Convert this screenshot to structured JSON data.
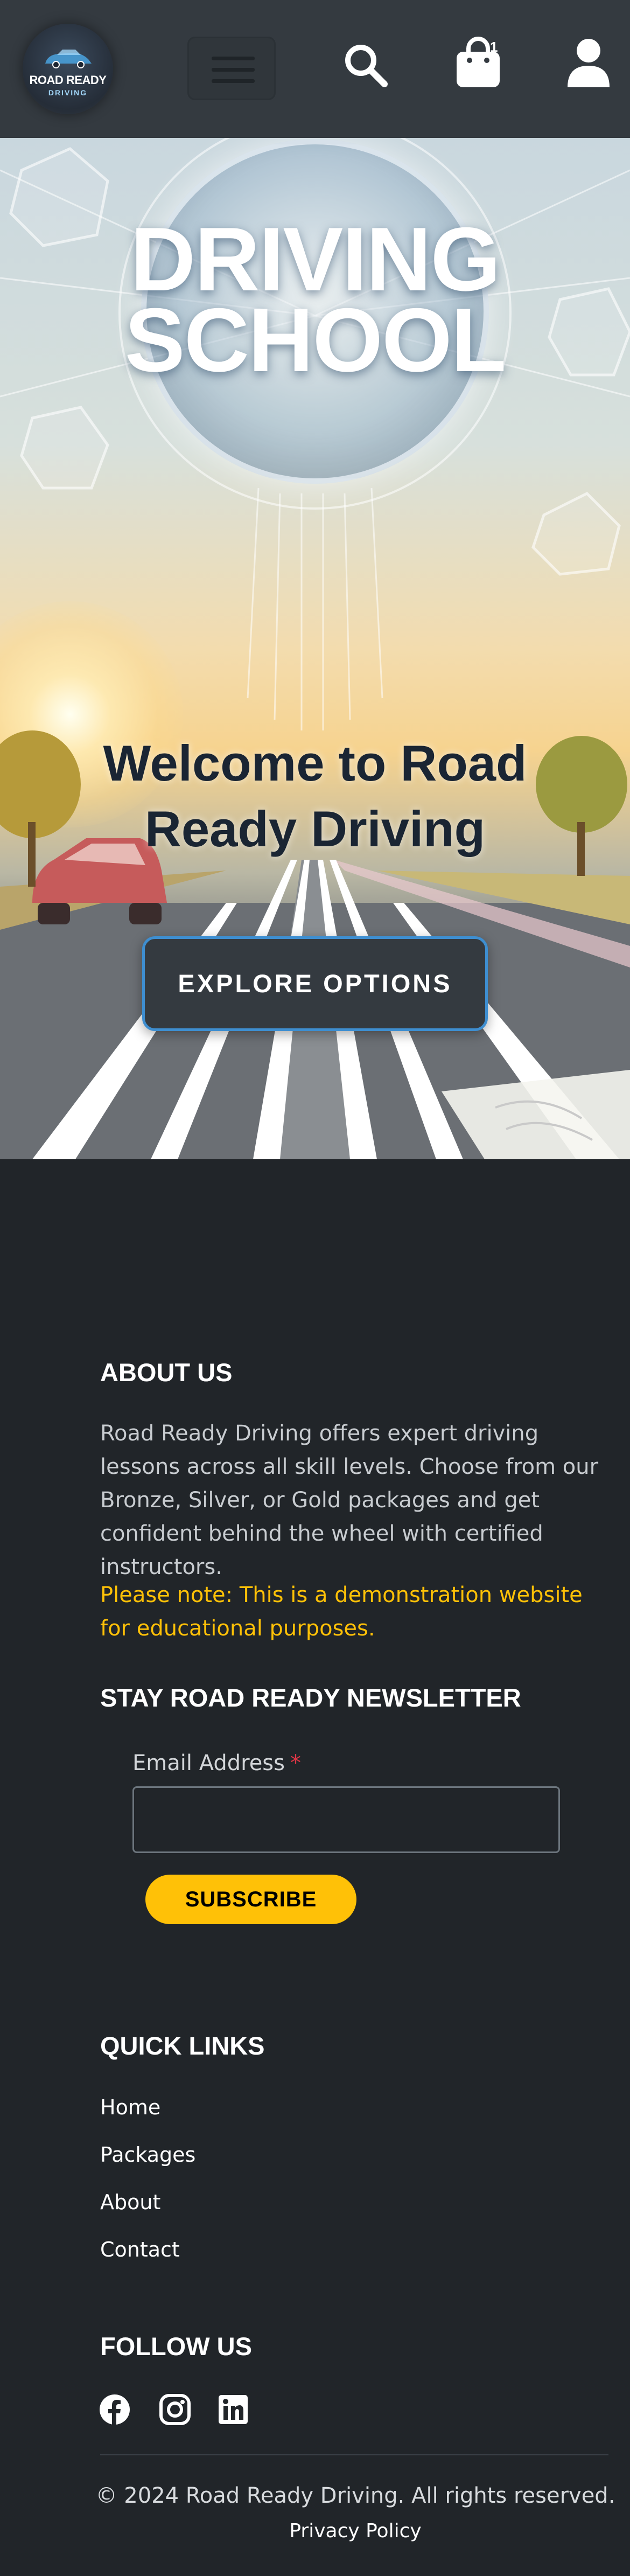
{
  "header": {
    "logo": {
      "line1": "ROAD READY",
      "line2": "DRIVING"
    },
    "menu_icon": "hamburger-menu-icon",
    "search_icon": "search-icon",
    "cart_icon": "shopping-bag-icon",
    "cart_count": "1",
    "account_icon": "user-icon"
  },
  "hero": {
    "image_title_line1": "DRIVING",
    "image_title_line2": "SCHOOL",
    "heading": "Welcome to Road Ready Driving",
    "cta_label": "EXPLORE OPTIONS"
  },
  "about": {
    "title": "ABOUT US",
    "text": "Road Ready Driving offers expert driving lessons across all skill levels. Choose from our Bronze, Silver, or Gold packages and get confident behind the wheel with certified instructors.",
    "note": "Please note: This is a demonstration website for educational purposes."
  },
  "newsletter": {
    "title": "STAY ROAD READY NEWSLETTER",
    "email_label": "Email Address",
    "required_mark": "*",
    "email_value": "",
    "subscribe_label": "SUBSCRIBE"
  },
  "quick_links": {
    "title": "QUICK LINKS",
    "items": [
      "Home",
      "Packages",
      "About",
      "Contact"
    ]
  },
  "follow": {
    "title": "FOLLOW US",
    "icons": [
      "facebook-icon",
      "instagram-icon",
      "linkedin-icon"
    ]
  },
  "footer": {
    "copyright": "© 2024 Road Ready Driving. All rights reserved.",
    "privacy": "Privacy Policy"
  },
  "colors": {
    "header_bg": "#343a40",
    "page_bg": "#212529",
    "accent_yellow": "#ffc107",
    "cta_border": "#3e8ed0",
    "required_red": "#dc3545"
  }
}
